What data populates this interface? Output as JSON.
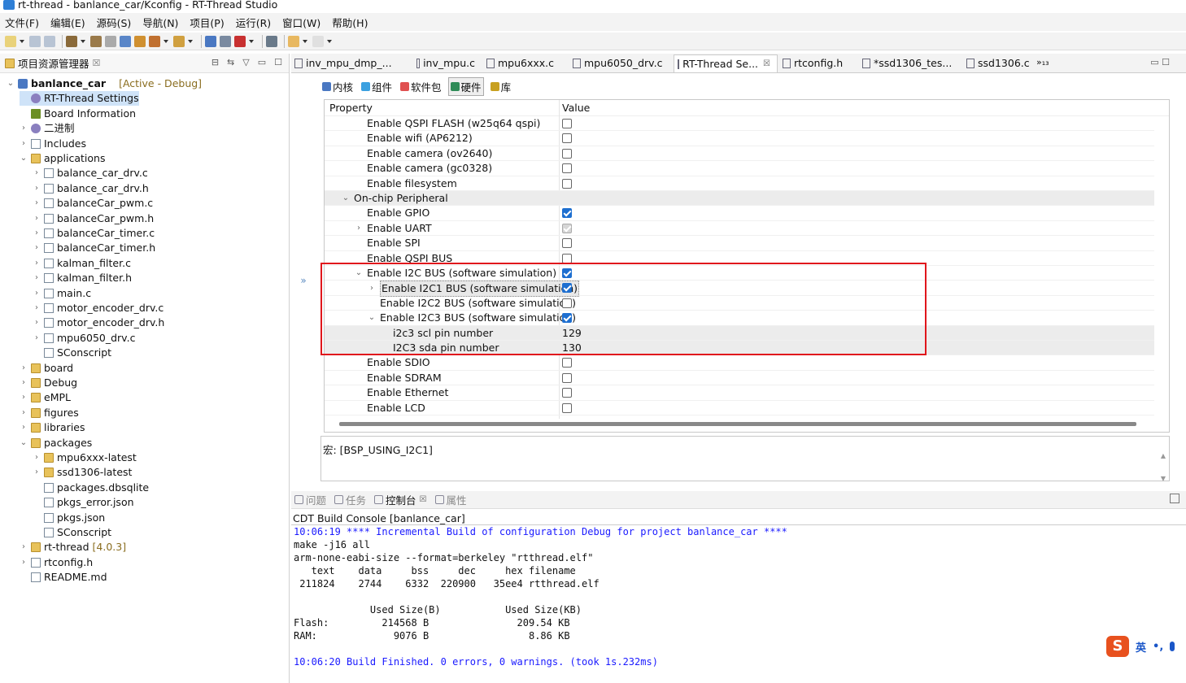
{
  "window": {
    "title": "rt-thread - banlance_car/Kconfig - RT-Thread Studio"
  },
  "menu": [
    "文件(F)",
    "编辑(E)",
    "源码(S)",
    "导航(N)",
    "项目(P)",
    "运行(R)",
    "窗口(W)",
    "帮助(H)"
  ],
  "explorer": {
    "title": "项目资源管理器",
    "close": "☒",
    "tree": [
      {
        "label": "banlance_car",
        "extra": "[Active - Debug]",
        "indent": 0,
        "chevron": "⌄",
        "icon": "proj",
        "bold": true
      },
      {
        "label": "RT-Thread Settings",
        "indent": 1,
        "chevron": "",
        "icon": "gear",
        "selected": true
      },
      {
        "label": "Board Information",
        "indent": 1,
        "chevron": "",
        "icon": "chip"
      },
      {
        "label": "二进制",
        "indent": 1,
        "chevron": "›",
        "icon": "gear"
      },
      {
        "label": "Includes",
        "indent": 1,
        "chevron": "›",
        "icon": "file"
      },
      {
        "label": "applications",
        "indent": 1,
        "chevron": "⌄",
        "icon": "folder"
      },
      {
        "label": "balance_car_drv.c",
        "indent": 2,
        "chevron": "›",
        "icon": "file"
      },
      {
        "label": "balance_car_drv.h",
        "indent": 2,
        "chevron": "›",
        "icon": "file"
      },
      {
        "label": "balanceCar_pwm.c",
        "indent": 2,
        "chevron": "›",
        "icon": "file"
      },
      {
        "label": "balanceCar_pwm.h",
        "indent": 2,
        "chevron": "›",
        "icon": "file"
      },
      {
        "label": "balanceCar_timer.c",
        "indent": 2,
        "chevron": "›",
        "icon": "file"
      },
      {
        "label": "balanceCar_timer.h",
        "indent": 2,
        "chevron": "›",
        "icon": "file"
      },
      {
        "label": "kalman_filter.c",
        "indent": 2,
        "chevron": "›",
        "icon": "file"
      },
      {
        "label": "kalman_filter.h",
        "indent": 2,
        "chevron": "›",
        "icon": "file"
      },
      {
        "label": "main.c",
        "indent": 2,
        "chevron": "›",
        "icon": "file"
      },
      {
        "label": "motor_encoder_drv.c",
        "indent": 2,
        "chevron": "›",
        "icon": "file"
      },
      {
        "label": "motor_encoder_drv.h",
        "indent": 2,
        "chevron": "›",
        "icon": "file"
      },
      {
        "label": "mpu6050_drv.c",
        "indent": 2,
        "chevron": "›",
        "icon": "file"
      },
      {
        "label": "SConscript",
        "indent": 2,
        "chevron": "",
        "icon": "file"
      },
      {
        "label": "board",
        "indent": 1,
        "chevron": "›",
        "icon": "folder"
      },
      {
        "label": "Debug",
        "indent": 1,
        "chevron": "›",
        "icon": "folder"
      },
      {
        "label": "eMPL",
        "indent": 1,
        "chevron": "›",
        "icon": "folder"
      },
      {
        "label": "figures",
        "indent": 1,
        "chevron": "›",
        "icon": "folder"
      },
      {
        "label": "libraries",
        "indent": 1,
        "chevron": "›",
        "icon": "folder"
      },
      {
        "label": "packages",
        "indent": 1,
        "chevron": "⌄",
        "icon": "folder"
      },
      {
        "label": "mpu6xxx-latest",
        "indent": 2,
        "chevron": "›",
        "icon": "folder"
      },
      {
        "label": "ssd1306-latest",
        "indent": 2,
        "chevron": "›",
        "icon": "folder"
      },
      {
        "label": "packages.dbsqlite",
        "indent": 2,
        "chevron": "",
        "icon": "file"
      },
      {
        "label": "pkgs_error.json",
        "indent": 2,
        "chevron": "",
        "icon": "file"
      },
      {
        "label": "pkgs.json",
        "indent": 2,
        "chevron": "",
        "icon": "file"
      },
      {
        "label": "SConscript",
        "indent": 2,
        "chevron": "",
        "icon": "file"
      },
      {
        "label": "rt-thread",
        "extra": "[4.0.3]",
        "indent": 1,
        "chevron": "›",
        "icon": "folder"
      },
      {
        "label": "rtconfig.h",
        "indent": 1,
        "chevron": "›",
        "icon": "file"
      },
      {
        "label": "README.md",
        "indent": 1,
        "chevron": "",
        "icon": "file"
      }
    ]
  },
  "editor": {
    "tabs": [
      {
        "label": "inv_mpu_dmp_...",
        "current": false
      },
      {
        "label": "inv_mpu.c",
        "current": false
      },
      {
        "label": "mpu6xxx.c",
        "current": false
      },
      {
        "label": "mpu6050_drv.c",
        "current": false
      },
      {
        "label": "RT-Thread Se...",
        "current": true,
        "close": "☒"
      },
      {
        "label": "rtconfig.h",
        "current": false
      },
      {
        "label": "*ssd1306_tes...",
        "current": false
      },
      {
        "label": "ssd1306.c",
        "current": false
      }
    ],
    "more_tabs": "»₁₃",
    "subtabs": [
      {
        "label": "内核",
        "color": "#4a78c2",
        "current": false
      },
      {
        "label": "组件",
        "color": "#3ba0e0",
        "current": false
      },
      {
        "label": "软件包",
        "color": "#e05050",
        "current": false
      },
      {
        "label": "硬件",
        "color": "#2e8b57",
        "current": true
      },
      {
        "label": "库",
        "color": "#c8a020",
        "current": false
      }
    ],
    "collapse_icon": "»",
    "table": {
      "col_property": "Property",
      "col_value": "Value",
      "rows": [
        {
          "label": "Enable QSPI FLASH (w25q64 qspi)",
          "level": 3,
          "type": "check",
          "checked": false
        },
        {
          "label": "Enable wifi (AP6212)",
          "level": 3,
          "type": "check",
          "checked": false
        },
        {
          "label": "Enable camera (ov2640)",
          "level": 3,
          "type": "check",
          "checked": false
        },
        {
          "label": "Enable camera (gc0328)",
          "level": 3,
          "type": "check",
          "checked": false
        },
        {
          "label": "Enable filesystem",
          "level": 3,
          "type": "check",
          "checked": false
        },
        {
          "label": "On-chip Peripheral",
          "level": 2,
          "type": "group",
          "chevron": "⌄"
        },
        {
          "label": "Enable GPIO",
          "level": 3,
          "type": "check",
          "checked": true
        },
        {
          "label": "Enable UART",
          "level": 3,
          "type": "check",
          "checked": "disabled",
          "chevron": "›"
        },
        {
          "label": "Enable SPI",
          "level": 3,
          "type": "check",
          "checked": false
        },
        {
          "label": "Enable QSPI BUS",
          "level": 3,
          "type": "check",
          "checked": false
        },
        {
          "label": "Enable I2C BUS (software simulation)",
          "level": 3,
          "type": "check",
          "checked": true,
          "chevron": "⌄"
        },
        {
          "label": "Enable I2C1 BUS (software simulation)",
          "level": 4,
          "type": "check",
          "checked": true,
          "chevron": "›",
          "highlight": true
        },
        {
          "label": "Enable I2C2 BUS (software simulation)",
          "level": 4,
          "type": "check",
          "checked": false
        },
        {
          "label": "Enable I2C3 BUS (software simulation)",
          "level": 4,
          "type": "check",
          "checked": true,
          "chevron": "⌄"
        },
        {
          "label": "i2c3 scl pin number",
          "level": 5,
          "type": "value",
          "value": "129",
          "shade": true
        },
        {
          "label": "I2C3 sda pin number",
          "level": 5,
          "type": "value",
          "value": "130",
          "shade": true
        },
        {
          "label": "Enable SDIO",
          "level": 3,
          "type": "check",
          "checked": false
        },
        {
          "label": "Enable SDRAM",
          "level": 3,
          "type": "check",
          "checked": false
        },
        {
          "label": "Enable Ethernet",
          "level": 3,
          "type": "check",
          "checked": false
        },
        {
          "label": "Enable LCD",
          "level": 3,
          "type": "check",
          "checked": false
        }
      ]
    },
    "macro": "宏: [BSP_USING_I2C1]"
  },
  "console": {
    "tabs": [
      {
        "label": "问题",
        "current": false
      },
      {
        "label": "任务",
        "current": false
      },
      {
        "label": "控制台",
        "current": true,
        "close": "☒"
      },
      {
        "label": "属性",
        "current": false
      }
    ],
    "title": "CDT Build Console [banlance_car]",
    "lines": [
      {
        "text": "10:06:19 **** Incremental Build of configuration Debug for project banlance_car ****",
        "blue": true
      },
      {
        "text": "make -j16 all",
        "blue": false
      },
      {
        "text": "arm-none-eabi-size --format=berkeley \"rtthread.elf\"",
        "blue": false
      },
      {
        "text": "   text    data     bss     dec     hex filename",
        "blue": false
      },
      {
        "text": " 211824    2744    6332  220900   35ee4 rtthread.elf",
        "blue": false
      },
      {
        "text": "",
        "blue": false
      },
      {
        "text": "             Used Size(B)           Used Size(KB)",
        "blue": false
      },
      {
        "text": "Flash:         214568 B               209.54 KB",
        "blue": false
      },
      {
        "text": "RAM:             9076 B                 8.86 KB",
        "blue": false
      },
      {
        "text": "",
        "blue": false
      },
      {
        "text": "10:06:20 Build Finished. 0 errors, 0 warnings. (took 1s.232ms)",
        "blue": true
      }
    ]
  },
  "ime": {
    "logo": "S",
    "lang": "英",
    "punct": "•,"
  }
}
